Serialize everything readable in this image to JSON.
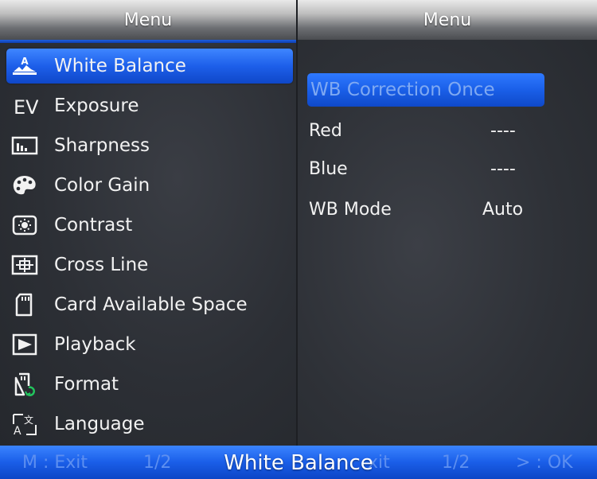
{
  "left_panel": {
    "title": "Menu",
    "items": [
      {
        "label": "White Balance",
        "icon": "white-balance-icon",
        "selected": true
      },
      {
        "label": "Exposure",
        "icon": "exposure-ev-icon"
      },
      {
        "label": "Sharpness",
        "icon": "sharpness-icon"
      },
      {
        "label": "Color Gain",
        "icon": "palette-icon"
      },
      {
        "label": "Contrast",
        "icon": "contrast-icon"
      },
      {
        "label": "Cross Line",
        "icon": "crosshair-icon"
      },
      {
        "label": "Card Available Space",
        "icon": "sd-card-icon"
      },
      {
        "label": "Playback",
        "icon": "play-icon"
      },
      {
        "label": "Format",
        "icon": "sd-card-refresh-icon"
      },
      {
        "label": "Language",
        "icon": "language-icon"
      }
    ]
  },
  "right_panel": {
    "title": "Menu",
    "wb_correction_label": "WB Correction Once",
    "settings": [
      {
        "label": "Red",
        "value": "----"
      },
      {
        "label": "Blue",
        "value": "----"
      },
      {
        "label": "WB Mode",
        "value": "Auto"
      }
    ]
  },
  "status_bar": {
    "title": "White Balance",
    "left_hint": "M : Exit",
    "left_page": "1/2",
    "mid_hint": "xit",
    "right_page": "1/2",
    "right_hint": "> : OK"
  },
  "colors": {
    "accent_blue": "#1d5fea",
    "text": "#f2f2f2"
  }
}
